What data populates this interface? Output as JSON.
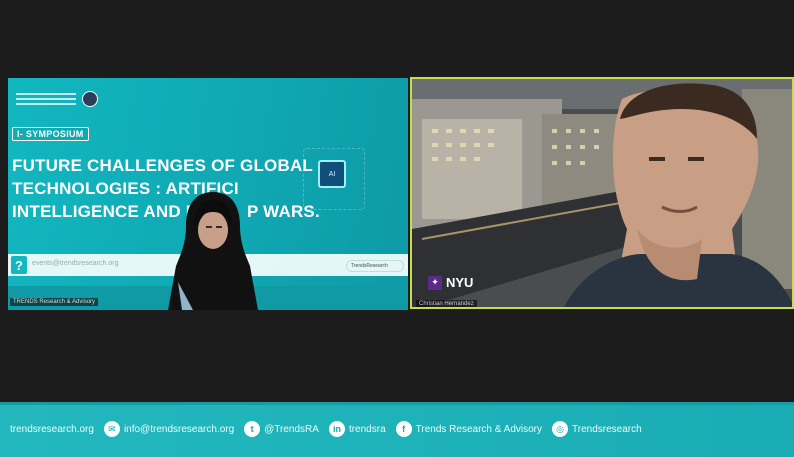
{
  "left_tile": {
    "symposium_label": "I- SYMPOSIUM",
    "title_lines": [
      "FUTURE CHALLENGES OF GLOBAL",
      "TECHNOLOGIES : ARTIFICI",
      "INTELLIGENCE AND MIC      P WARS."
    ],
    "chip_text": "AI",
    "email_small": "events@trendsresearch.org",
    "trends_badge": "TrendsResearch",
    "name_tag": "TRENDS Research & Advisory",
    "question_icon": "?"
  },
  "right_tile": {
    "logo_text": "NYU",
    "logo_icon": "torch-icon",
    "name_tag": "Christian Hernandez",
    "active_speaker_color": "#c6dd4e"
  },
  "footer": {
    "items": [
      {
        "icon": "",
        "text": "trendsresearch.org"
      },
      {
        "icon": "✉",
        "text": "info@trendsresearch.org"
      },
      {
        "icon": "🐦",
        "text": "@TrendsRA"
      },
      {
        "icon": "in",
        "text": "trendsra"
      },
      {
        "icon": "f",
        "text": "Trends Research & Advisory"
      },
      {
        "icon": "◎",
        "text": "Trendsresearch"
      }
    ],
    "color": "#1aacb4"
  }
}
